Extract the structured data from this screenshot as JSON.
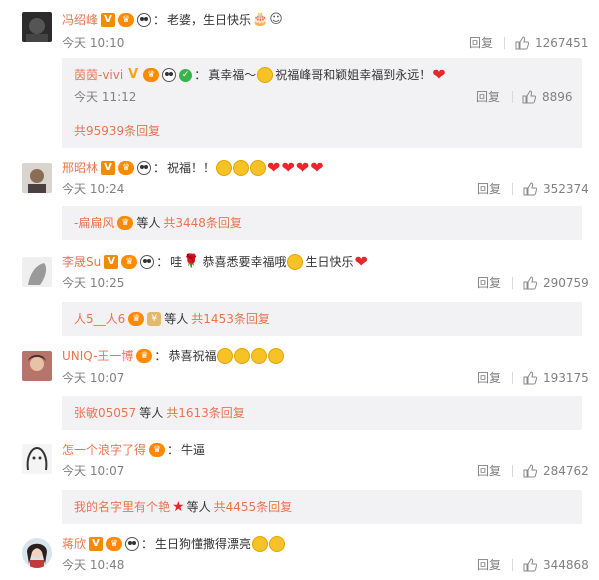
{
  "common": {
    "reply_label": "回复"
  },
  "comments": [
    {
      "user": "冯绍峰",
      "sep": "：",
      "text": "老婆，生日快乐",
      "time": "今天 10:10",
      "likes": "1267451",
      "sub": {
        "user": "茵茵-vivi",
        "sep": "：",
        "text_a": "真幸福～",
        "text_b": "祝福峰哥和颖姐幸福到永远！",
        "time": "今天 11:12",
        "likes": "8896",
        "more": "共95939条回复"
      }
    },
    {
      "user": "邢昭林",
      "sep": "：",
      "text": "祝福！！",
      "time": "今天 10:24",
      "likes": "352374",
      "sub_user": "-扁扁风",
      "sub_mid": "等人",
      "sub_more": "共3448条回复"
    },
    {
      "user": "李晟Su",
      "sep": "：",
      "text_a": "哇",
      "text_b": "恭喜悉要幸福哦",
      "text_c": "生日快乐",
      "time": "今天 10:25",
      "likes": "290759",
      "sub_user": "人5__人6",
      "sub_mid": "等人",
      "sub_more": "共1453条回复"
    },
    {
      "user": "UNIQ-王一博",
      "sep": "：",
      "text": "恭喜祝福",
      "time": "今天 10:07",
      "likes": "193175",
      "sub_user": "张敏05057",
      "sub_mid": "等人",
      "sub_more": "共1613条回复"
    },
    {
      "user": "怎一个浪字了得",
      "sep": "：",
      "text": "牛逼",
      "time": "今天 10:07",
      "likes": "284762",
      "sub_user": "我的名字里有个艳",
      "sub_mid": "等人",
      "sub_more": "共4455条回复"
    },
    {
      "user": "蒋欣",
      "sep": "：",
      "text": "生日狗懂撒得漂亮",
      "time": "今天 10:48",
      "likes": "344868"
    }
  ],
  "icons": {
    "like": "thumbs-up-icon",
    "vip": "vip-crown-icon",
    "verified": "verified-v-icon"
  },
  "colors": {
    "accent": "#eb7350",
    "meta": "#808080",
    "subbox": "#f2f2f5",
    "heart": "#e8262c"
  }
}
